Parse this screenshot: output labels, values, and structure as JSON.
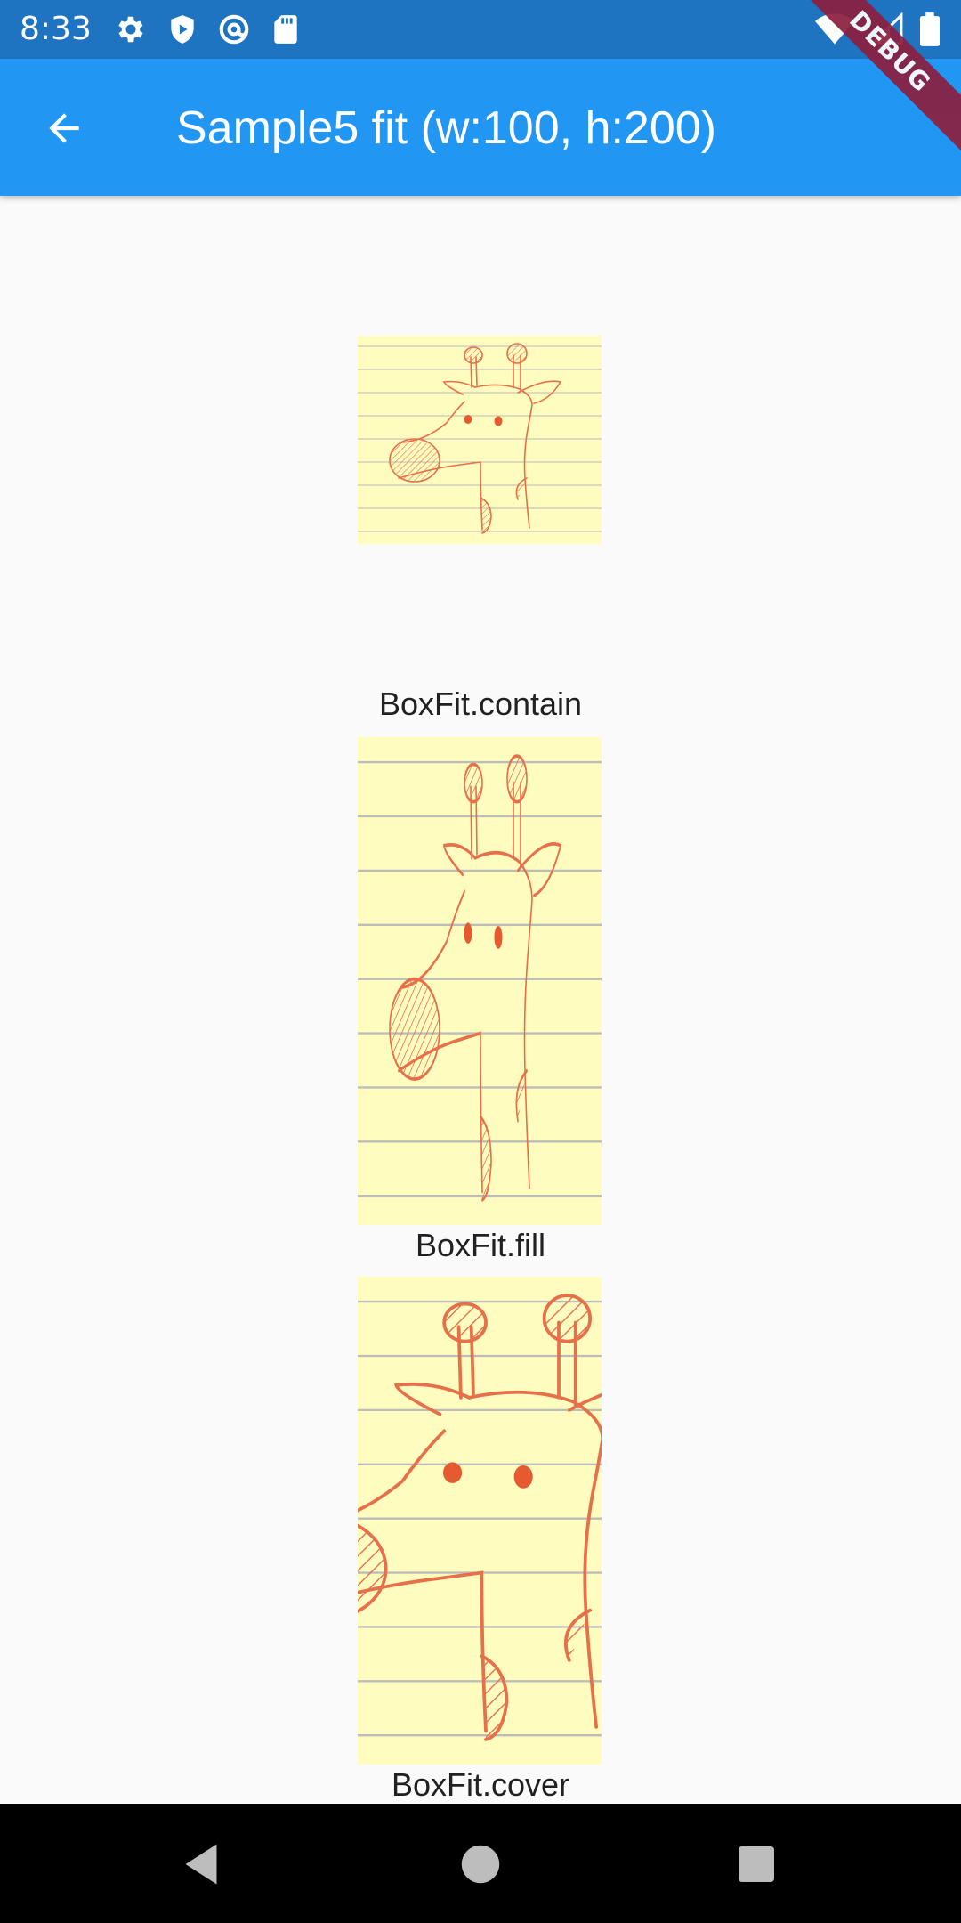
{
  "status_bar": {
    "time": "8:33",
    "left_icons": [
      "gear-icon",
      "shield-play-icon",
      "at-sign-icon",
      "sd-card-icon"
    ],
    "right_icons": [
      "wifi-icon",
      "cell-signal-icon",
      "battery-icon"
    ]
  },
  "app_bar": {
    "title": "Sample5 fit (w:100, h:200)",
    "back_icon": "arrow-left-icon"
  },
  "debug_banner": "DEBUG",
  "samples": [
    {
      "caption": "BoxFit.contain"
    },
    {
      "caption": "BoxFit.fill"
    },
    {
      "caption": "BoxFit.cover"
    }
  ],
  "nav_bar": {
    "buttons": [
      "back-triangle-icon",
      "home-circle-icon",
      "recents-square-icon"
    ]
  },
  "colors": {
    "status_bar": "#1f74c2",
    "app_bar": "#2196f3",
    "paper": "#fffcc0",
    "sketch": "#e5704a"
  }
}
